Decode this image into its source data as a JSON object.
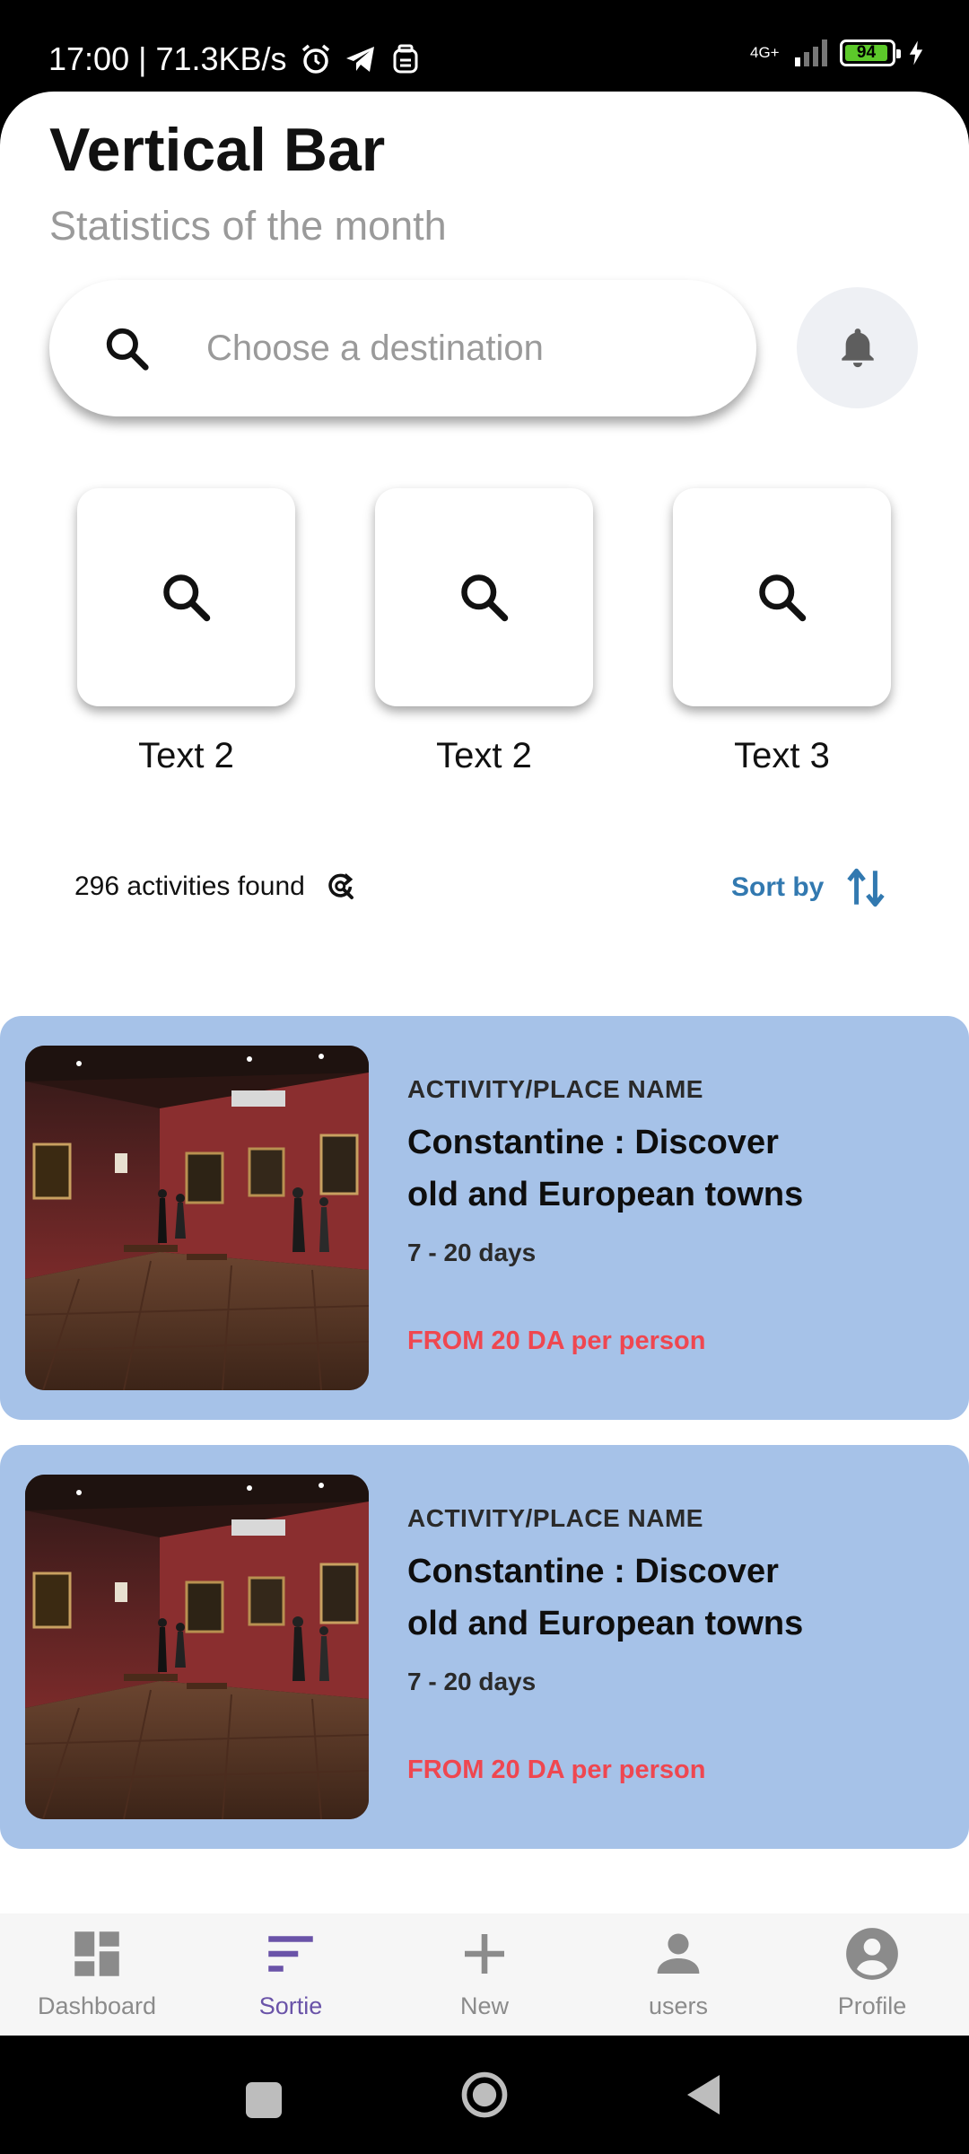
{
  "status_bar": {
    "time_speed": "17:00 | 71.3KB/s",
    "network": "4G+",
    "battery": "94"
  },
  "header": {
    "title": "Vertical Bar",
    "subtitle": "Statistics of the month"
  },
  "search": {
    "placeholder": "Choose a destination"
  },
  "quick_tiles": [
    {
      "label": "Text 2",
      "icon": "search-icon"
    },
    {
      "label": "Text 2",
      "icon": "search-icon"
    },
    {
      "label": "Text 3",
      "icon": "search-icon"
    }
  ],
  "results": {
    "count_label": "296 activities found",
    "sort_label": "Sort by"
  },
  "cards": [
    {
      "eyebrow": "ACTIVITY/PLACE NAME",
      "title": "Constantine : Discover\n old and European towns",
      "duration": "7 - 20 days",
      "price": "FROM 20 DA per person"
    },
    {
      "eyebrow": "ACTIVITY/PLACE NAME",
      "title": "Constantine : Discover\n old and European towns",
      "duration": "7 - 20 days",
      "price": "FROM 20 DA per person"
    }
  ],
  "bottom_nav": [
    {
      "label": "Dashboard",
      "icon": "dashboard-icon",
      "active": false
    },
    {
      "label": "Sortie",
      "icon": "sort-lines-icon",
      "active": true
    },
    {
      "label": "New",
      "icon": "plus-icon",
      "active": false
    },
    {
      "label": "users",
      "icon": "person-icon",
      "active": false
    },
    {
      "label": "Profile",
      "icon": "account-circle-icon",
      "active": false
    }
  ],
  "colors": {
    "card_background": "#a6c2e8",
    "price": "#ef4750",
    "sort_accent": "#3279b0",
    "nav_active": "#6a53a8"
  }
}
